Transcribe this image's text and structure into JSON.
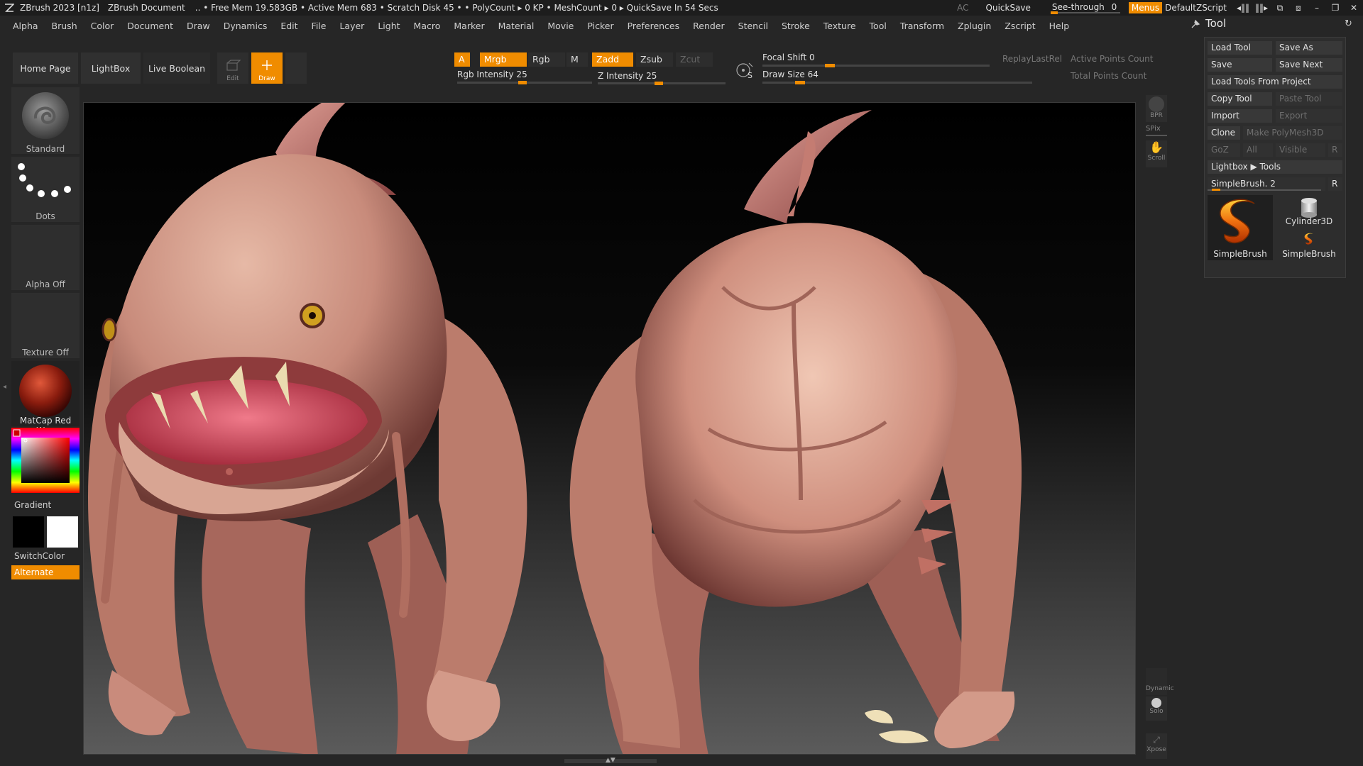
{
  "titlebar": {
    "app": "ZBrush 2023 [n1z]",
    "document": "ZBrush Document",
    "status": ".. • Free Mem 19.583GB • Active Mem 683 • Scratch Disk 45 •  • PolyCount ▸ 0 KP  • MeshCount ▸ 0  ▸ QuickSave In 54 Secs",
    "ac": "AC",
    "quicksave": "QuickSave",
    "see_through_label": "See-through",
    "see_through_value": "0",
    "menus": "Menus",
    "default_zscript": "DefaultZScript"
  },
  "menubar": [
    "Alpha",
    "Brush",
    "Color",
    "Document",
    "Draw",
    "Dynamics",
    "Edit",
    "File",
    "Layer",
    "Light",
    "Macro",
    "Marker",
    "Material",
    "Movie",
    "Picker",
    "Preferences",
    "Render",
    "Stencil",
    "Stroke",
    "Texture",
    "Tool",
    "Transform",
    "Zplugin",
    "Zscript",
    "Help"
  ],
  "shelf": {
    "home_page": "Home Page",
    "lightbox": "LightBox",
    "live_boolean": "Live Boolean",
    "edit": "Edit",
    "draw": "Draw",
    "a": "A",
    "mrgb": "Mrgb",
    "rgb": "Rgb",
    "m": "M",
    "zadd": "Zadd",
    "zsub": "Zsub",
    "zcut": "Zcut",
    "rgb_intensity": "Rgb Intensity 25",
    "z_intensity": "Z Intensity 25",
    "focal_shift": "Focal Shift 0",
    "draw_size": "Draw Size 64",
    "replay_last_rel": "ReplayLastRel",
    "active_points": "Active Points Count",
    "total_points": "Total Points Count",
    "s": "S"
  },
  "leftshelf": {
    "brush": "Standard",
    "stroke": "Dots",
    "alpha": "Alpha Off",
    "texture": "Texture Off",
    "material": "MatCap Red Wax",
    "gradient": "Gradient",
    "switchcolor": "SwitchColor",
    "alternate": "Alternate"
  },
  "sidestrip": {
    "bpr": "BPR",
    "spix": "SPix",
    "scroll": "Scroll",
    "dynamic": "Dynamic",
    "solo": "Solo",
    "xpose": "Xpose"
  },
  "toolpanel": {
    "title": "Tool",
    "load_tool": "Load Tool",
    "save_as": "Save As",
    "save": "Save",
    "save_next": "Save Next",
    "load_from_project": "Load Tools From Project",
    "copy_tool": "Copy Tool",
    "paste_tool": "Paste Tool",
    "import": "Import",
    "export": "Export",
    "clone": "Clone",
    "make_polymesh": "Make PolyMesh3D",
    "goz": "GoZ",
    "all": "All",
    "visible": "Visible",
    "r": "R",
    "lightbox_tools": "Lightbox ▶ Tools",
    "simplebrush_slider": "SimpleBrush. 2",
    "thumb_main": "SimpleBrush",
    "thumb_cylinder": "Cylinder3D",
    "thumb_small": "SimpleBrush"
  },
  "colors": {
    "accent": "#f08c00",
    "panel": "#262626",
    "creature_skin": "#d59a8a"
  }
}
